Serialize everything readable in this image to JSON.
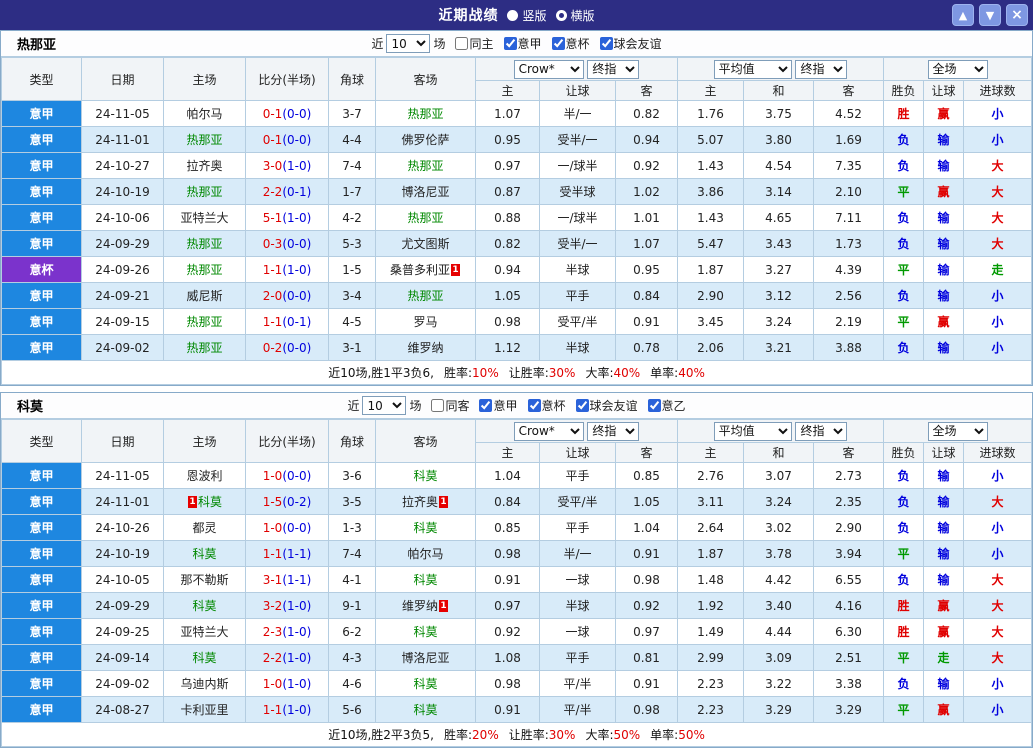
{
  "colors": {
    "titlebar_bg": "#2d2d84",
    "league_blue": "#1e87e0",
    "league_purple": "#7b33cc",
    "focal": "#008800",
    "win": "#e00000",
    "loss": "#0000dd",
    "draw": "#009900",
    "row_alt": "#d8ebf9"
  },
  "titlebar": {
    "title": "近期战绩",
    "view_options": [
      {
        "label": "竖版",
        "selected": false
      },
      {
        "label": "横版",
        "selected": true
      }
    ],
    "buttons": {
      "up": "▲",
      "down": "▼",
      "close": "×"
    }
  },
  "filter_labels": {
    "near": "近",
    "count": "10",
    "matches": "场"
  },
  "table_headers": {
    "type": "类型",
    "date": "日期",
    "home": "主场",
    "score": "比分(半场)",
    "corner": "角球",
    "away": "客场",
    "bookmaker": "Crow*",
    "final1": "终指",
    "average": "平均值",
    "final2": "终指",
    "fulltime": "全场",
    "sub": [
      "主",
      "让球",
      "客",
      "主",
      "和",
      "客",
      "胜负",
      "让球",
      "进球数"
    ]
  },
  "sections": [
    {
      "team": "热那亚",
      "same_label": "同主",
      "same_checked": false,
      "leagues": [
        {
          "label": "意甲",
          "checked": true
        },
        {
          "label": "意杯",
          "checked": true
        },
        {
          "label": "球会友谊",
          "checked": true
        }
      ],
      "rows": [
        {
          "lg": "意甲",
          "date": "24-11-05",
          "home": "帕尔马",
          "hrc": "",
          "score": "0-1",
          "half": "(0-0)",
          "corner": "3-7",
          "away": "热那亚",
          "arc": "",
          "odds": [
            "1.07",
            "半/一",
            "0.82"
          ],
          "avg": [
            "1.76",
            "3.75",
            "4.52"
          ],
          "res": [
            "胜",
            "赢",
            "小"
          ]
        },
        {
          "lg": "意甲",
          "date": "24-11-01",
          "home": "热那亚",
          "hrc": "",
          "score": "0-1",
          "half": "(0-0)",
          "corner": "4-4",
          "away": "佛罗伦萨",
          "arc": "",
          "odds": [
            "0.95",
            "受半/一",
            "0.94"
          ],
          "avg": [
            "5.07",
            "3.80",
            "1.69"
          ],
          "res": [
            "负",
            "输",
            "小"
          ]
        },
        {
          "lg": "意甲",
          "date": "24-10-27",
          "home": "拉齐奥",
          "hrc": "",
          "score": "3-0",
          "half": "(1-0)",
          "corner": "7-4",
          "away": "热那亚",
          "arc": "",
          "odds": [
            "0.97",
            "一/球半",
            "0.92"
          ],
          "avg": [
            "1.43",
            "4.54",
            "7.35"
          ],
          "res": [
            "负",
            "输",
            "大"
          ]
        },
        {
          "lg": "意甲",
          "date": "24-10-19",
          "home": "热那亚",
          "hrc": "",
          "score": "2-2",
          "half": "(0-1)",
          "corner": "1-7",
          "away": "博洛尼亚",
          "arc": "",
          "odds": [
            "0.87",
            "受半球",
            "1.02"
          ],
          "avg": [
            "3.86",
            "3.14",
            "2.10"
          ],
          "res": [
            "平",
            "赢",
            "大"
          ]
        },
        {
          "lg": "意甲",
          "date": "24-10-06",
          "home": "亚特兰大",
          "hrc": "",
          "score": "5-1",
          "half": "(1-0)",
          "corner": "4-2",
          "away": "热那亚",
          "arc": "",
          "odds": [
            "0.88",
            "一/球半",
            "1.01"
          ],
          "avg": [
            "1.43",
            "4.65",
            "7.11"
          ],
          "res": [
            "负",
            "输",
            "大"
          ]
        },
        {
          "lg": "意甲",
          "date": "24-09-29",
          "home": "热那亚",
          "hrc": "",
          "score": "0-3",
          "half": "(0-0)",
          "corner": "5-3",
          "away": "尤文图斯",
          "arc": "",
          "odds": [
            "0.82",
            "受半/一",
            "1.07"
          ],
          "avg": [
            "5.47",
            "3.43",
            "1.73"
          ],
          "res": [
            "负",
            "输",
            "大"
          ]
        },
        {
          "lg": "意杯",
          "date": "24-09-26",
          "home": "热那亚",
          "hrc": "",
          "score": "1-1",
          "half": "(1-0)",
          "corner": "1-5",
          "away": "桑普多利亚",
          "arc": "after",
          "odds": [
            "0.94",
            "半球",
            "0.95"
          ],
          "avg": [
            "1.87",
            "3.27",
            "4.39"
          ],
          "res": [
            "平",
            "输",
            "走"
          ]
        },
        {
          "lg": "意甲",
          "date": "24-09-21",
          "home": "威尼斯",
          "hrc": "",
          "score": "2-0",
          "half": "(0-0)",
          "corner": "3-4",
          "away": "热那亚",
          "arc": "",
          "odds": [
            "1.05",
            "平手",
            "0.84"
          ],
          "avg": [
            "2.90",
            "3.12",
            "2.56"
          ],
          "res": [
            "负",
            "输",
            "小"
          ]
        },
        {
          "lg": "意甲",
          "date": "24-09-15",
          "home": "热那亚",
          "hrc": "",
          "score": "1-1",
          "half": "(0-1)",
          "corner": "4-5",
          "away": "罗马",
          "arc": "",
          "odds": [
            "0.98",
            "受平/半",
            "0.91"
          ],
          "avg": [
            "3.45",
            "3.24",
            "2.19"
          ],
          "res": [
            "平",
            "赢",
            "小"
          ]
        },
        {
          "lg": "意甲",
          "date": "24-09-02",
          "home": "热那亚",
          "hrc": "",
          "score": "0-2",
          "half": "(0-0)",
          "corner": "3-1",
          "away": "维罗纳",
          "arc": "",
          "odds": [
            "1.12",
            "半球",
            "0.78"
          ],
          "avg": [
            "2.06",
            "3.21",
            "3.88"
          ],
          "res": [
            "负",
            "输",
            "小"
          ]
        }
      ],
      "summary_prefix": "近10场,胜1平3负6,",
      "summary_stats": [
        {
          "label": "胜率:",
          "value": "10%"
        },
        {
          "label": "让胜率:",
          "value": "30%"
        },
        {
          "label": "大率:",
          "value": "40%"
        },
        {
          "label": "单率:",
          "value": "40%"
        }
      ]
    },
    {
      "team": "科莫",
      "same_label": "同客",
      "same_checked": false,
      "leagues": [
        {
          "label": "意甲",
          "checked": true
        },
        {
          "label": "意杯",
          "checked": true
        },
        {
          "label": "球会友谊",
          "checked": true
        },
        {
          "label": "意乙",
          "checked": true
        }
      ],
      "rows": [
        {
          "lg": "意甲",
          "date": "24-11-05",
          "home": "恩波利",
          "hrc": "",
          "score": "1-0",
          "half": "(0-0)",
          "corner": "3-6",
          "away": "科莫",
          "arc": "",
          "odds": [
            "1.04",
            "平手",
            "0.85"
          ],
          "avg": [
            "2.76",
            "3.07",
            "2.73"
          ],
          "res": [
            "负",
            "输",
            "小"
          ]
        },
        {
          "lg": "意甲",
          "date": "24-11-01",
          "home": "科莫",
          "hrc": "before",
          "score": "1-5",
          "half": "(0-2)",
          "corner": "3-5",
          "away": "拉齐奥",
          "arc": "after",
          "odds": [
            "0.84",
            "受平/半",
            "1.05"
          ],
          "avg": [
            "3.11",
            "3.24",
            "2.35"
          ],
          "res": [
            "负",
            "输",
            "大"
          ]
        },
        {
          "lg": "意甲",
          "date": "24-10-26",
          "home": "都灵",
          "hrc": "",
          "score": "1-0",
          "half": "(0-0)",
          "corner": "1-3",
          "away": "科莫",
          "arc": "",
          "odds": [
            "0.85",
            "平手",
            "1.04"
          ],
          "avg": [
            "2.64",
            "3.02",
            "2.90"
          ],
          "res": [
            "负",
            "输",
            "小"
          ]
        },
        {
          "lg": "意甲",
          "date": "24-10-19",
          "home": "科莫",
          "hrc": "",
          "score": "1-1",
          "half": "(1-1)",
          "corner": "7-4",
          "away": "帕尔马",
          "arc": "",
          "odds": [
            "0.98",
            "半/一",
            "0.91"
          ],
          "avg": [
            "1.87",
            "3.78",
            "3.94"
          ],
          "res": [
            "平",
            "输",
            "小"
          ]
        },
        {
          "lg": "意甲",
          "date": "24-10-05",
          "home": "那不勒斯",
          "hrc": "",
          "score": "3-1",
          "half": "(1-1)",
          "corner": "4-1",
          "away": "科莫",
          "arc": "",
          "odds": [
            "0.91",
            "一球",
            "0.98"
          ],
          "avg": [
            "1.48",
            "4.42",
            "6.55"
          ],
          "res": [
            "负",
            "输",
            "大"
          ]
        },
        {
          "lg": "意甲",
          "date": "24-09-29",
          "home": "科莫",
          "hrc": "",
          "score": "3-2",
          "half": "(1-0)",
          "corner": "9-1",
          "away": "维罗纳",
          "arc": "after",
          "odds": [
            "0.97",
            "半球",
            "0.92"
          ],
          "avg": [
            "1.92",
            "3.40",
            "4.16"
          ],
          "res": [
            "胜",
            "赢",
            "大"
          ]
        },
        {
          "lg": "意甲",
          "date": "24-09-25",
          "home": "亚特兰大",
          "hrc": "",
          "score": "2-3",
          "half": "(1-0)",
          "corner": "6-2",
          "away": "科莫",
          "arc": "",
          "odds": [
            "0.92",
            "一球",
            "0.97"
          ],
          "avg": [
            "1.49",
            "4.44",
            "6.30"
          ],
          "res": [
            "胜",
            "赢",
            "大"
          ]
        },
        {
          "lg": "意甲",
          "date": "24-09-14",
          "home": "科莫",
          "hrc": "",
          "score": "2-2",
          "half": "(1-0)",
          "corner": "4-3",
          "away": "博洛尼亚",
          "arc": "",
          "odds": [
            "1.08",
            "平手",
            "0.81"
          ],
          "avg": [
            "2.99",
            "3.09",
            "2.51"
          ],
          "res": [
            "平",
            "走",
            "大"
          ]
        },
        {
          "lg": "意甲",
          "date": "24-09-02",
          "home": "乌迪内斯",
          "hrc": "",
          "score": "1-0",
          "half": "(1-0)",
          "corner": "4-6",
          "away": "科莫",
          "arc": "",
          "odds": [
            "0.98",
            "平/半",
            "0.91"
          ],
          "avg": [
            "2.23",
            "3.22",
            "3.38"
          ],
          "res": [
            "负",
            "输",
            "小"
          ]
        },
        {
          "lg": "意甲",
          "date": "24-08-27",
          "home": "卡利亚里",
          "hrc": "",
          "score": "1-1",
          "half": "(1-0)",
          "corner": "5-6",
          "away": "科莫",
          "arc": "",
          "odds": [
            "0.91",
            "平/半",
            "0.98"
          ],
          "avg": [
            "2.23",
            "3.29",
            "3.29"
          ],
          "res": [
            "平",
            "赢",
            "小"
          ]
        }
      ],
      "summary_prefix": "近10场,胜2平3负5,",
      "summary_stats": [
        {
          "label": "胜率:",
          "value": "20%"
        },
        {
          "label": "让胜率:",
          "value": "30%"
        },
        {
          "label": "大率:",
          "value": "50%"
        },
        {
          "label": "单率:",
          "value": "50%"
        }
      ]
    }
  ]
}
